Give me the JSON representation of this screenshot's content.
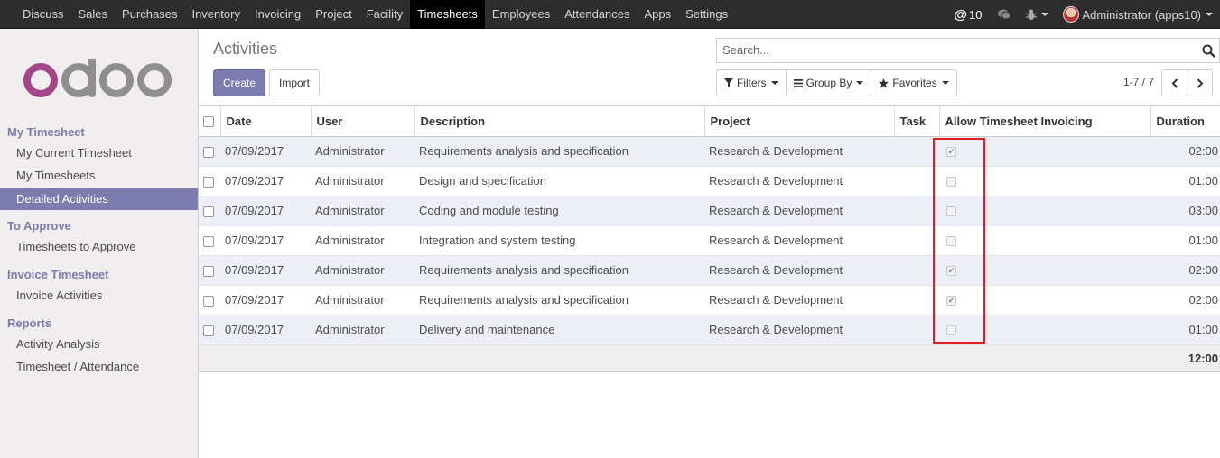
{
  "topbar": {
    "menu": [
      "Discuss",
      "Sales",
      "Purchases",
      "Inventory",
      "Invoicing",
      "Project",
      "Facility",
      "Timesheets",
      "Employees",
      "Attendances",
      "Apps",
      "Settings"
    ],
    "active": "Timesheets",
    "notifications": "10",
    "user": "Administrator (apps10)"
  },
  "sidebar": {
    "my_timesheet": "My Timesheet",
    "my_current_timesheet": "My Current Timesheet",
    "my_timesheets": "My Timesheets",
    "detailed_activities": "Detailed Activities",
    "to_approve": "To Approve",
    "timesheets_to_approve": "Timesheets to Approve",
    "invoice_timesheet": "Invoice Timesheet",
    "invoice_activities": "Invoice Activities",
    "reports": "Reports",
    "activity_analysis": "Activity Analysis",
    "timesheet_attendance": "Timesheet / Attendance"
  },
  "control": {
    "title": "Activities",
    "create": "Create",
    "import": "Import",
    "search_placeholder": "Search...",
    "filters": "Filters",
    "group_by": "Group By",
    "favorites": "Favorites",
    "pager": "1-7 / 7"
  },
  "table": {
    "headers": {
      "date": "Date",
      "user": "User",
      "description": "Description",
      "project": "Project",
      "task": "Task",
      "allow_invoicing": "Allow Timesheet Invoicing",
      "duration": "Duration"
    },
    "rows": [
      {
        "date": "07/09/2017",
        "user": "Administrator",
        "description": "Requirements analysis and specification",
        "project": "Research & Development",
        "task": "",
        "allow": true,
        "duration": "02:00"
      },
      {
        "date": "07/09/2017",
        "user": "Administrator",
        "description": "Design and specification",
        "project": "Research & Development",
        "task": "",
        "allow": false,
        "duration": "01:00"
      },
      {
        "date": "07/09/2017",
        "user": "Administrator",
        "description": "Coding and module testing",
        "project": "Research & Development",
        "task": "",
        "allow": false,
        "duration": "03:00"
      },
      {
        "date": "07/09/2017",
        "user": "Administrator",
        "description": "Integration and system testing",
        "project": "Research & Development",
        "task": "",
        "allow": false,
        "duration": "01:00"
      },
      {
        "date": "07/09/2017",
        "user": "Administrator",
        "description": "Requirements analysis and specification",
        "project": "Research & Development",
        "task": "",
        "allow": true,
        "duration": "02:00"
      },
      {
        "date": "07/09/2017",
        "user": "Administrator",
        "description": "Requirements analysis and specification",
        "project": "Research & Development",
        "task": "",
        "allow": true,
        "duration": "02:00"
      },
      {
        "date": "07/09/2017",
        "user": "Administrator",
        "description": "Delivery and maintenance",
        "project": "Research & Development",
        "task": "",
        "allow": false,
        "duration": "01:00"
      }
    ],
    "total_duration": "12:00"
  },
  "colors": {
    "navbar": "#2d2d2d",
    "brand": "#7c7bad",
    "highlight": "#e02020"
  }
}
